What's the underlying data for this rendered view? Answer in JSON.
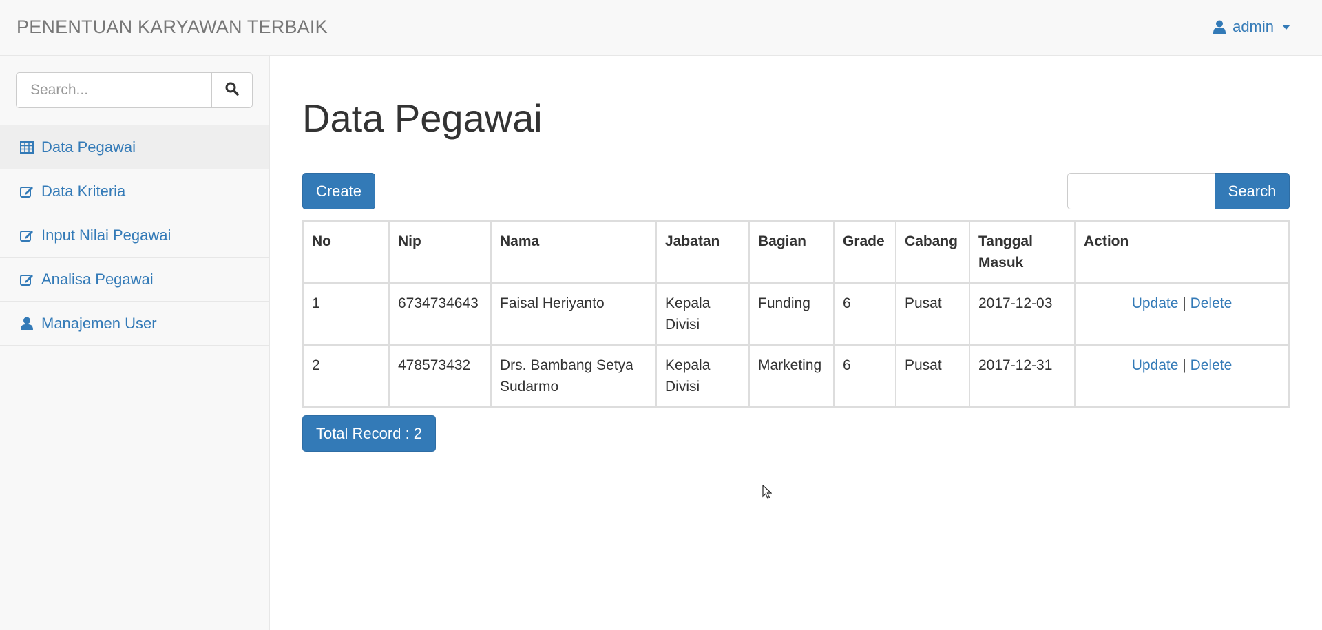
{
  "app": {
    "brand": "PENENTUAN KARYAWAN TERBAIK",
    "user": "admin",
    "accent_color": "#337ab7"
  },
  "sidebar": {
    "search_placeholder": "Search...",
    "items": [
      {
        "label": "Data Pegawai",
        "icon": "table-icon",
        "active": true
      },
      {
        "label": "Data Kriteria",
        "icon": "edit-icon",
        "active": false
      },
      {
        "label": "Input Nilai Pegawai",
        "icon": "edit-icon",
        "active": false
      },
      {
        "label": "Analisa Pegawai",
        "icon": "edit-icon",
        "active": false
      },
      {
        "label": "Manajemen User",
        "icon": "user-icon",
        "active": false
      }
    ]
  },
  "main": {
    "title": "Data Pegawai",
    "create_label": "Create",
    "search_value": "",
    "search_label": "Search",
    "table": {
      "headers": [
        "No",
        "Nip",
        "Nama",
        "Jabatan",
        "Bagian",
        "Grade",
        "Cabang",
        "Tanggal Masuk",
        "Action"
      ],
      "rows": [
        {
          "no": "1",
          "nip": "6734734643",
          "nama": "Faisal Heriyanto",
          "jabatan": "Kepala Divisi",
          "bagian": "Funding",
          "grade": "6",
          "cabang": "Pusat",
          "tanggal": "2017-12-03"
        },
        {
          "no": "2",
          "nip": "478573432",
          "nama": "Drs. Bambang Setya Sudarmo",
          "jabatan": "Kepala Divisi",
          "bagian": "Marketing",
          "grade": "6",
          "cabang": "Pusat",
          "tanggal": "2017-12-31"
        }
      ],
      "update_label": "Update",
      "separator": "|",
      "delete_label": "Delete"
    },
    "total_label": "Total Record : 2"
  }
}
